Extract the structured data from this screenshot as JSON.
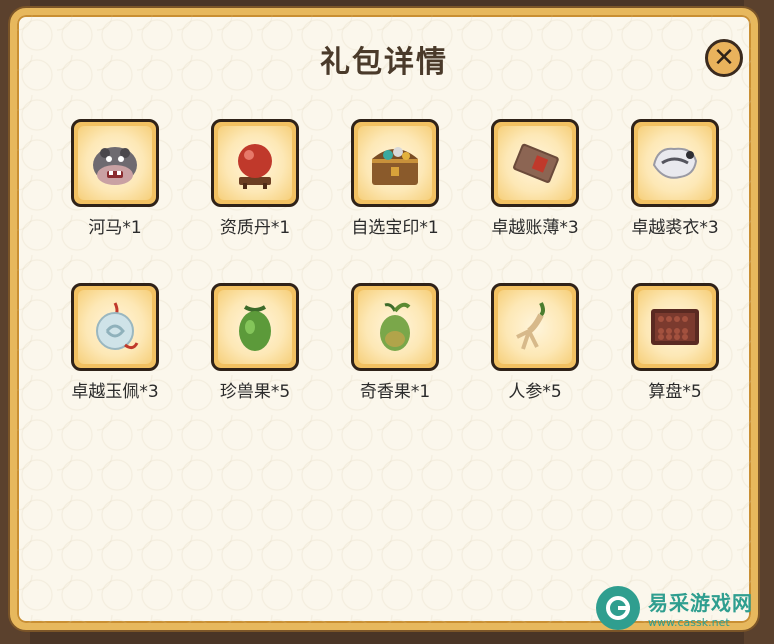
{
  "dialog": {
    "title": "礼包详情",
    "close_label": "✕"
  },
  "items": [
    {
      "label": "河马*1",
      "icon": "hippo-icon"
    },
    {
      "label": "资质丹*1",
      "icon": "red-orb-icon"
    },
    {
      "label": "自选宝印*1",
      "icon": "treasure-chest-icon"
    },
    {
      "label": "卓越账薄*3",
      "icon": "ledger-book-icon"
    },
    {
      "label": "卓越裘衣*3",
      "icon": "fur-robe-icon"
    },
    {
      "label": "卓越玉佩*3",
      "icon": "jade-pendant-icon"
    },
    {
      "label": "珍兽果*5",
      "icon": "green-fruit-icon"
    },
    {
      "label": "奇香果*1",
      "icon": "fragrant-fruit-icon"
    },
    {
      "label": "人参*5",
      "icon": "ginseng-icon"
    },
    {
      "label": "算盘*5",
      "icon": "abacus-icon"
    }
  ],
  "watermark": {
    "name": "易采游戏网",
    "url": "www.cassk.net"
  }
}
